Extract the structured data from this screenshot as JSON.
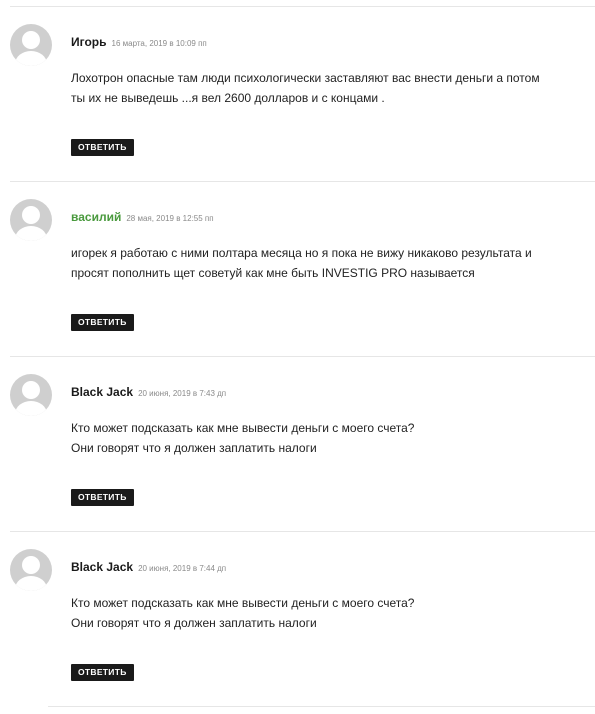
{
  "comments": [
    {
      "author": "Игорь",
      "author_linked": false,
      "date": "16 марта, 2019 в 10:09 пп",
      "lines": [
        "Лохотрон опасные там люди психологически заставляют вас внести деньги а потом",
        "ты их не выведешь ...я вел 2600 долларов и с концами ."
      ],
      "reply_label": "ОТВЕТИТЬ"
    },
    {
      "author": "василий",
      "author_linked": true,
      "date": "28 мая, 2019 в 12:55 пп",
      "lines": [
        "игорек я работаю с ними полтара месяца но я пока не вижу никаково результата и",
        "просят пополнить щет советуй как мне быть INVESTIG PRO называется"
      ],
      "reply_label": "ОТВЕТИТЬ"
    },
    {
      "author": "Black Jack",
      "author_linked": false,
      "date": "20 июня, 2019 в 7:43 дп",
      "lines": [
        "Кто может подсказать как мне вывести деньги с моего счета?",
        "Они говорят что я должен заплатить налоги"
      ],
      "reply_label": "ОТВЕТИТЬ"
    },
    {
      "author": "Black Jack",
      "author_linked": false,
      "date": "20 июня, 2019 в 7:44 дп",
      "lines": [
        "Кто может подсказать как мне вывести деньги с моего счета?",
        "Они говорят что я должен заплатить налоги"
      ],
      "reply_label": "ОТВЕТИТЬ"
    }
  ],
  "colors": {
    "linked_author": "#4a9a3e",
    "reply_button_bg": "#1a1a1a",
    "divider": "#e6e6e6",
    "avatar_bg": "#cfcfcf"
  },
  "icons": {
    "avatar": "default-user-avatar-icon"
  }
}
